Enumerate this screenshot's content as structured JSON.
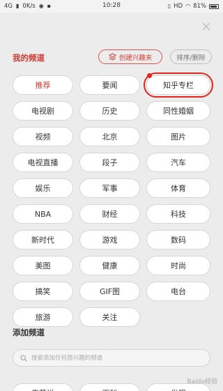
{
  "status_bar": {
    "network": "4G",
    "speed": "0K/s",
    "time": "10:28",
    "hd": "HD",
    "battery": "81%"
  },
  "header": {
    "my_channels_title": "我的频道",
    "create_button": "创建兴趣夹",
    "sort_button": "排序/删除"
  },
  "my_channels": [
    {
      "label": "推荐",
      "active": true
    },
    {
      "label": "要闻"
    },
    {
      "label": "知乎专栏",
      "highlighted": true
    },
    {
      "label": "电视剧"
    },
    {
      "label": "历史"
    },
    {
      "label": "同性婚姻"
    },
    {
      "label": "视频"
    },
    {
      "label": "北京"
    },
    {
      "label": "图片"
    },
    {
      "label": "电视直播"
    },
    {
      "label": "段子"
    },
    {
      "label": "汽车"
    },
    {
      "label": "娱乐"
    },
    {
      "label": "军事"
    },
    {
      "label": "体育"
    },
    {
      "label": "NBA"
    },
    {
      "label": "财经"
    },
    {
      "label": "科技"
    },
    {
      "label": "新时代"
    },
    {
      "label": "游戏"
    },
    {
      "label": "数码"
    },
    {
      "label": "美图"
    },
    {
      "label": "健康"
    },
    {
      "label": "时尚"
    },
    {
      "label": "搞笑"
    },
    {
      "label": "GIF图"
    },
    {
      "label": "电台"
    },
    {
      "label": "旅游"
    },
    {
      "label": "关注"
    }
  ],
  "add_section": {
    "title": "添加频道",
    "search_placeholder": "搜索添加任何感兴趣的频道"
  },
  "more_channels": [
    {
      "label": "奇葩说"
    },
    {
      "label": "百科"
    },
    {
      "label": "发现"
    }
  ],
  "watermark": "Baidu经验"
}
